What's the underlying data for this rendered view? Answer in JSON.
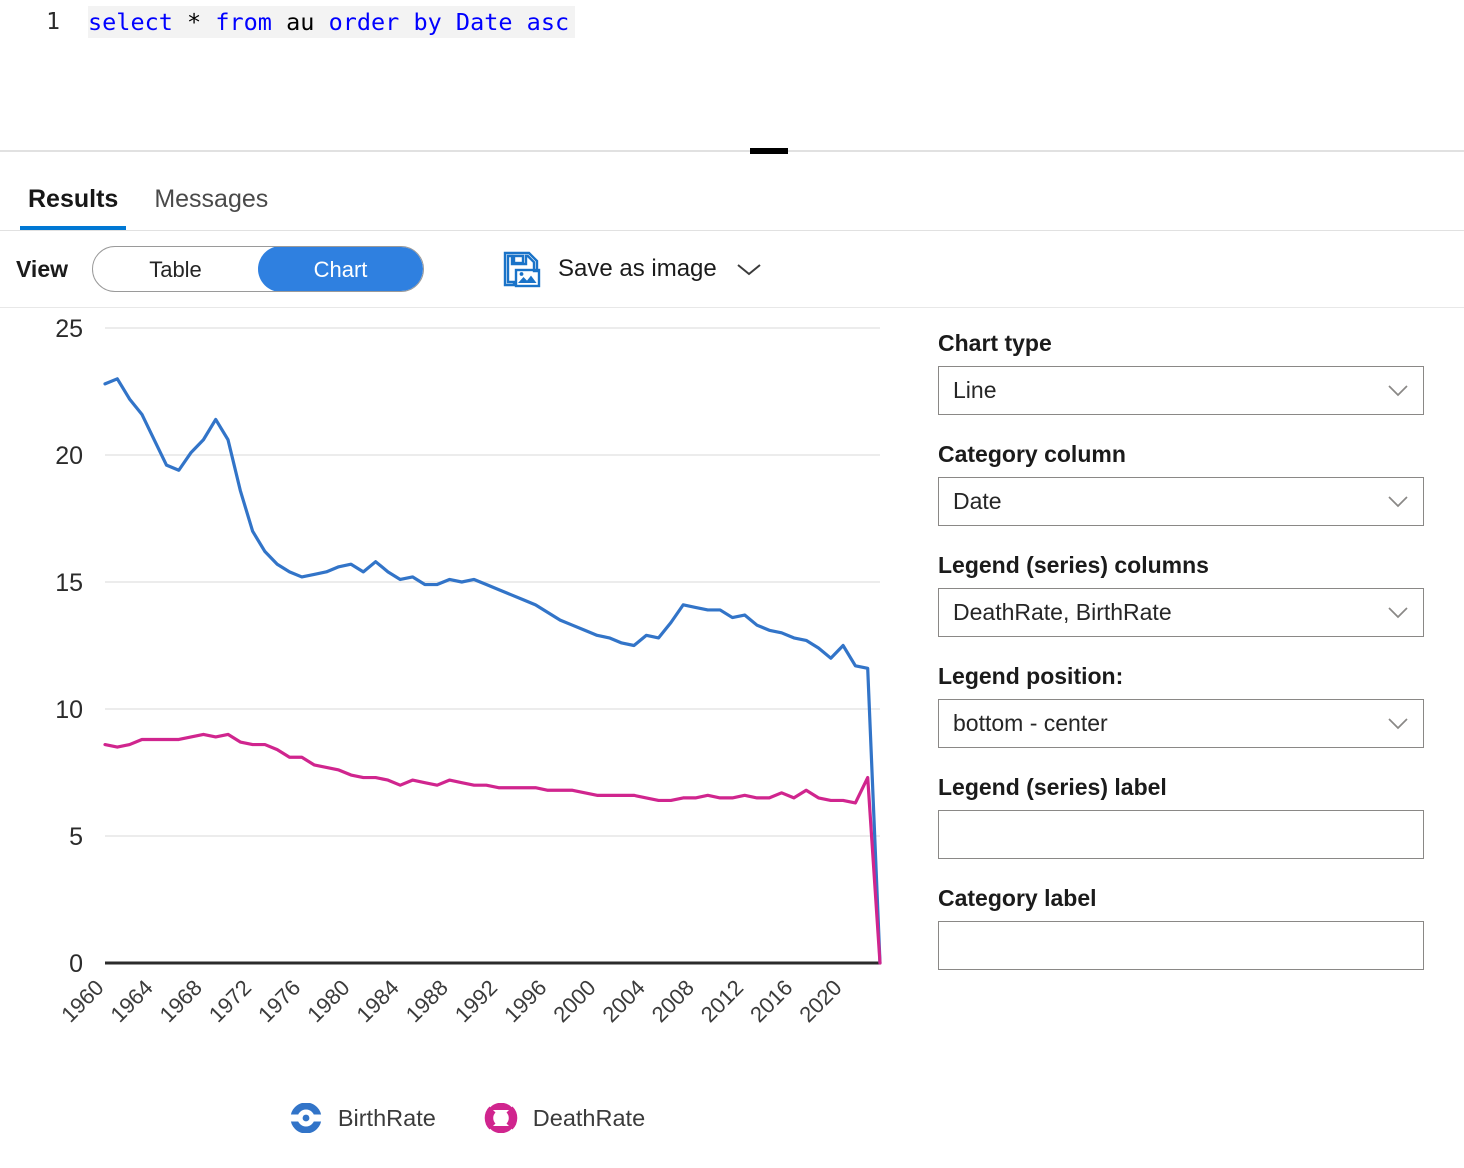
{
  "editor": {
    "line_number": "1",
    "sql_tokens": [
      {
        "t": "select",
        "k": "kw"
      },
      {
        "t": " ",
        "k": "idt"
      },
      {
        "t": "*",
        "k": "op"
      },
      {
        "t": " ",
        "k": "idt"
      },
      {
        "t": "from",
        "k": "kw"
      },
      {
        "t": " ",
        "k": "idt"
      },
      {
        "t": "au",
        "k": "idt"
      },
      {
        "t": " ",
        "k": "idt"
      },
      {
        "t": "order",
        "k": "kw"
      },
      {
        "t": " ",
        "k": "idt"
      },
      {
        "t": "by",
        "k": "kw"
      },
      {
        "t": " ",
        "k": "idt"
      },
      {
        "t": "Date",
        "k": "kw"
      },
      {
        "t": " ",
        "k": "idt"
      },
      {
        "t": "asc",
        "k": "kw"
      }
    ],
    "sql_text": "select * from au order by Date asc"
  },
  "tabs": {
    "results": "Results",
    "messages": "Messages",
    "active": "Results"
  },
  "toolbar": {
    "view_label": "View",
    "table_label": "Table",
    "chart_label": "Chart",
    "selected_view": "Chart",
    "save_label": "Save as image",
    "save_icon": "save-image-icon",
    "caret_icon": "chevron-down-icon"
  },
  "options": {
    "chart_type": {
      "label": "Chart type",
      "value": "Line"
    },
    "category_column": {
      "label": "Category column",
      "value": "Date"
    },
    "legend_columns": {
      "label": "Legend (series) columns",
      "value": "DeathRate, BirthRate"
    },
    "legend_position": {
      "label": "Legend position:",
      "value": "bottom - center"
    },
    "legend_label": {
      "label": "Legend (series) label",
      "value": "",
      "placeholder": ""
    },
    "category_label": {
      "label": "Category label",
      "value": "",
      "placeholder": ""
    }
  },
  "colors": {
    "birth_rate": "#3274c8",
    "death_rate": "#d0258e",
    "accent": "#0078d4",
    "toggle_selected": "#2f80e0",
    "gridline": "#e6e6e6",
    "axis": "#2b2b2b"
  },
  "chart_data": {
    "type": "line",
    "title": "",
    "xlabel": "",
    "ylabel": "",
    "ylim": [
      0,
      25
    ],
    "yticks": [
      0,
      5,
      10,
      15,
      20,
      25
    ],
    "grid": true,
    "legend_position": "bottom-center",
    "x_tick_step": 4,
    "x_tick_labels": [
      "1960",
      "1964",
      "1968",
      "1972",
      "1976",
      "1980",
      "1984",
      "1988",
      "1992",
      "1996",
      "2000",
      "2004",
      "2008",
      "2012",
      "2016",
      "2020"
    ],
    "x": [
      1960,
      1961,
      1962,
      1963,
      1964,
      1965,
      1966,
      1967,
      1968,
      1969,
      1970,
      1971,
      1972,
      1973,
      1974,
      1975,
      1976,
      1977,
      1978,
      1979,
      1980,
      1981,
      1982,
      1983,
      1984,
      1985,
      1986,
      1987,
      1988,
      1989,
      1990,
      1991,
      1992,
      1993,
      1994,
      1995,
      1996,
      1997,
      1998,
      1999,
      2000,
      2001,
      2002,
      2003,
      2004,
      2005,
      2006,
      2007,
      2008,
      2009,
      2010,
      2011,
      2012,
      2013,
      2014,
      2015,
      2016,
      2017,
      2018,
      2019,
      2020,
      2021,
      2022,
      2023
    ],
    "series": [
      {
        "name": "BirthRate",
        "color": "#3274c8",
        "marker": "circle-line",
        "values": [
          22.8,
          23.0,
          22.2,
          21.6,
          20.6,
          19.6,
          19.4,
          20.1,
          20.6,
          21.4,
          20.6,
          18.6,
          17.0,
          16.2,
          15.7,
          15.4,
          15.2,
          15.3,
          15.4,
          15.6,
          15.7,
          15.4,
          15.8,
          15.4,
          15.1,
          15.2,
          14.9,
          14.9,
          15.1,
          15.0,
          15.1,
          14.9,
          14.7,
          14.5,
          14.3,
          14.1,
          13.8,
          13.5,
          13.3,
          13.1,
          12.9,
          12.8,
          12.6,
          12.5,
          12.9,
          12.8,
          13.4,
          14.1,
          14.0,
          13.9,
          13.9,
          13.6,
          13.7,
          13.3,
          13.1,
          13.0,
          12.8,
          12.7,
          12.4,
          12.0,
          12.5,
          11.7,
          11.6,
          0.0
        ]
      },
      {
        "name": "DeathRate",
        "color": "#d0258e",
        "marker": "circle-line",
        "values": [
          8.6,
          8.5,
          8.6,
          8.8,
          8.8,
          8.8,
          8.8,
          8.9,
          9.0,
          8.9,
          9.0,
          8.7,
          8.6,
          8.6,
          8.4,
          8.1,
          8.1,
          7.8,
          7.7,
          7.6,
          7.4,
          7.3,
          7.3,
          7.2,
          7.0,
          7.2,
          7.1,
          7.0,
          7.2,
          7.1,
          7.0,
          7.0,
          6.9,
          6.9,
          6.9,
          6.9,
          6.8,
          6.8,
          6.8,
          6.7,
          6.6,
          6.6,
          6.6,
          6.6,
          6.5,
          6.4,
          6.4,
          6.5,
          6.5,
          6.6,
          6.5,
          6.5,
          6.6,
          6.5,
          6.5,
          6.7,
          6.5,
          6.8,
          6.5,
          6.4,
          6.4,
          6.3,
          7.3,
          0.0
        ]
      }
    ]
  },
  "legend": [
    {
      "label": "BirthRate",
      "color": "#3274c8",
      "marker": "circle-line-icon"
    },
    {
      "label": "DeathRate",
      "color": "#d0258e",
      "marker": "circle-line-icon"
    }
  ]
}
